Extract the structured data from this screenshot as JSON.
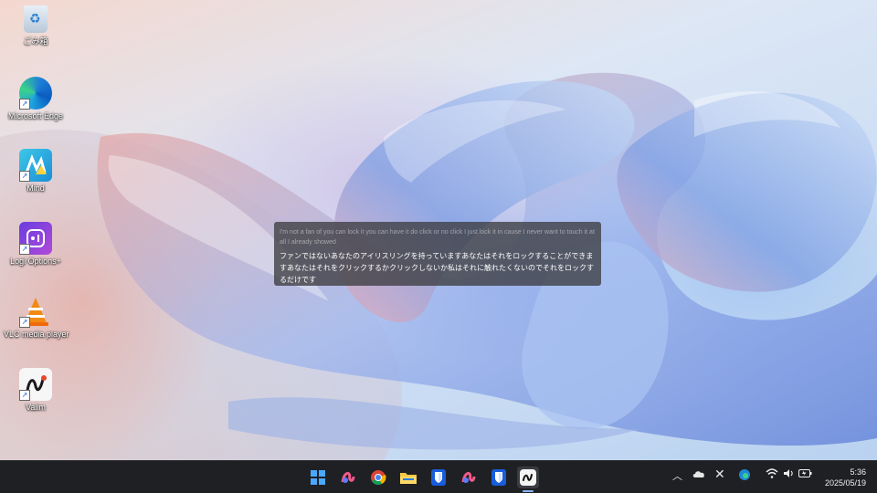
{
  "desktop": {
    "icons": [
      {
        "label": "ごみ箱",
        "icon": "recycle-bin-icon"
      },
      {
        "label": "Microsoft Edge",
        "icon": "edge-icon"
      },
      {
        "label": "Mind",
        "icon": "mind-icon"
      },
      {
        "label": "Logi Options+",
        "icon": "logi-options-icon"
      },
      {
        "label": "VLC media player",
        "icon": "vlc-icon"
      },
      {
        "label": "Vaiim",
        "icon": "vaiim-icon"
      }
    ]
  },
  "subtitle": {
    "english": "I'm not a fan of you can lock it you can have it do click or no click I just lock it in cause I never want to touch it at all I already showed",
    "japanese": "ファンではないあなたのアイリスリングを持っていますあなたはそれをロックすることができますあなたはそれをクリックするかクリックしないか私はそれに触れたくないのでそれをロックするだけです"
  },
  "taskbar": {
    "apps": [
      "start-icon",
      "copilot-icon",
      "chrome-icon",
      "file-explorer-icon",
      "bitwarden-icon",
      "copilot-icon",
      "bitwarden-icon",
      "vaiim-icon"
    ],
    "tray": [
      "chevron-up-icon",
      "onedrive-icon",
      "x-icon",
      "edge-icon",
      "wifi-icon",
      "volume-icon",
      "battery-icon"
    ],
    "time": "5:36",
    "date": "2025/05/19"
  },
  "colors": {
    "taskbar": "#1f2024",
    "accent": "#1a73e8"
  }
}
